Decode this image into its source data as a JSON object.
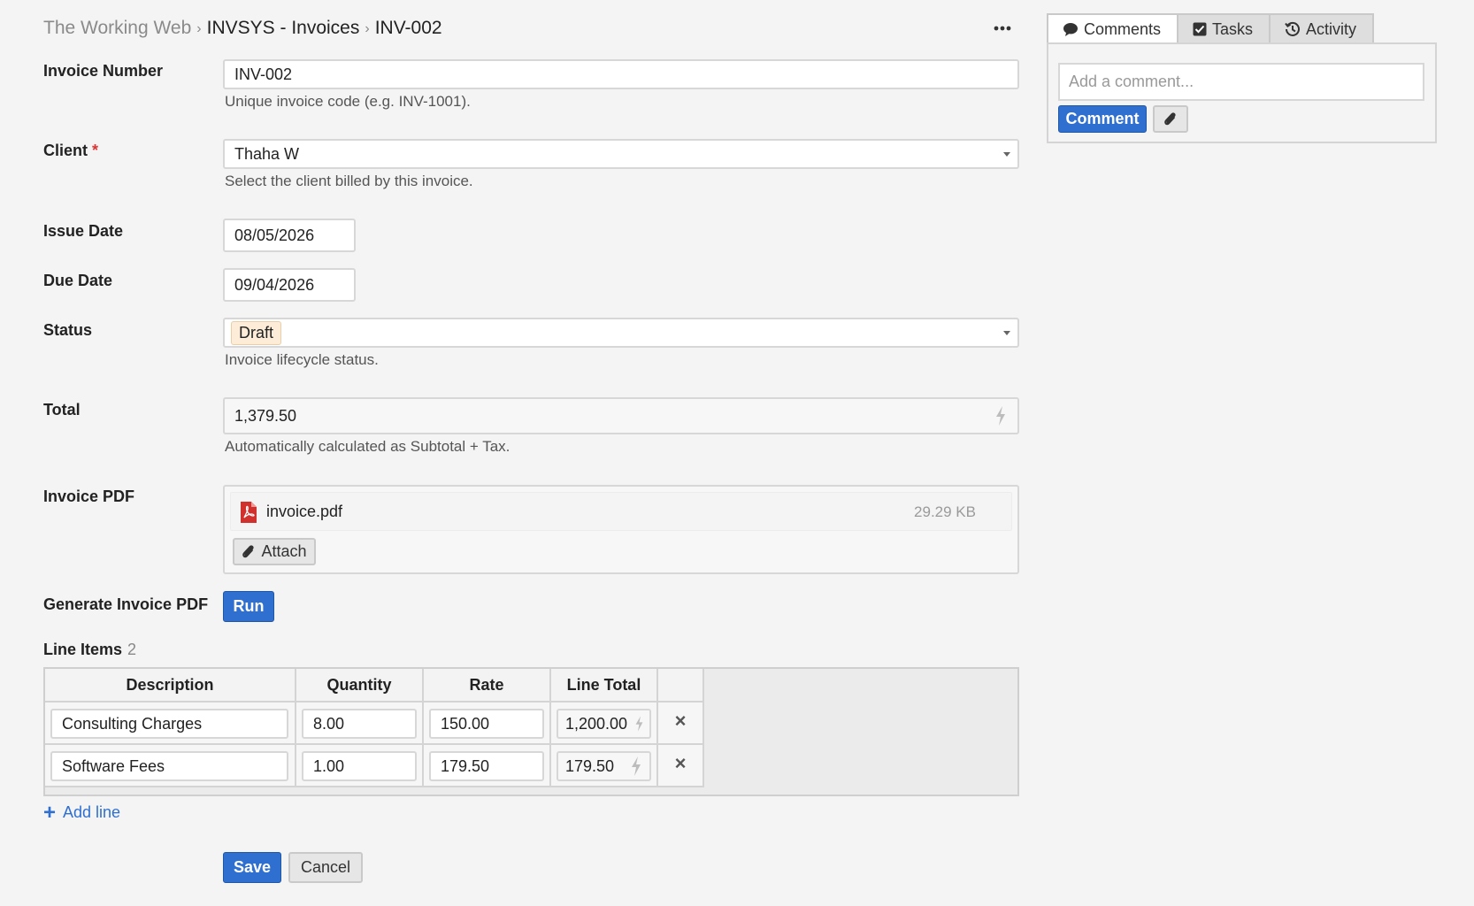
{
  "breadcrumb": {
    "root": "The Working Web",
    "section": "INVSYS - Invoices",
    "current": "INV-002",
    "separator": "›"
  },
  "more_menu_icon": "ellipsis-icon",
  "form": {
    "invoice_number": {
      "label": "Invoice Number",
      "value": "INV-002",
      "help": "Unique invoice code (e.g. INV-1001)."
    },
    "client": {
      "label": "Client",
      "required_mark": "*",
      "value": "Thaha W",
      "help": "Select the client billed by this invoice."
    },
    "issue_date": {
      "label": "Issue Date",
      "value": "08/05/2026"
    },
    "due_date": {
      "label": "Due Date",
      "value": "09/04/2026"
    },
    "status": {
      "label": "Status",
      "value": "Draft",
      "help": "Invoice lifecycle status.",
      "badge_color": "#fcecd8"
    },
    "total": {
      "label": "Total",
      "value": "1,379.50",
      "help": "Automatically calculated as Subtotal + Tax."
    },
    "invoice_pdf": {
      "label": "Invoice PDF",
      "file_name": "invoice.pdf",
      "file_size": "29.29 KB",
      "attach_label": "Attach"
    },
    "generate_pdf": {
      "label": "Generate Invoice PDF",
      "run_label": "Run"
    }
  },
  "line_items": {
    "title": "Line Items",
    "count": "2",
    "columns": [
      "Description",
      "Quantity",
      "Rate",
      "Line Total"
    ],
    "rows": [
      {
        "description": "Consulting Charges",
        "quantity": "8.00",
        "rate": "150.00",
        "line_total": "1,200.00"
      },
      {
        "description": "Software Fees",
        "quantity": "1.00",
        "rate": "179.50",
        "line_total": "179.50"
      }
    ],
    "remove_glyph": "×",
    "add_line_label": "Add line"
  },
  "actions": {
    "save_label": "Save",
    "cancel_label": "Cancel"
  },
  "side_panel": {
    "tabs": [
      {
        "label": "Comments",
        "icon": "speech-bubble-icon"
      },
      {
        "label": "Tasks",
        "icon": "checkbox-icon"
      },
      {
        "label": "Activity",
        "icon": "history-icon"
      }
    ],
    "comment_placeholder": "Add a comment...",
    "comment_button": "Comment",
    "attach_icon": "paperclip-icon"
  },
  "colors": {
    "accent": "#2f6fd0",
    "pdf_icon": "#d0312d",
    "background": "#f4f4f4"
  }
}
